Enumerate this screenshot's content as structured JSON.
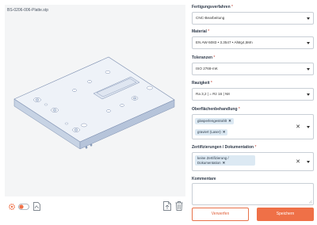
{
  "viewer": {
    "file_name": "BS-0206-006-Platte.stp"
  },
  "form": {
    "manufacturing": {
      "label": "Fertigungsverfahren",
      "value": "CNC-Bearbeitung"
    },
    "material": {
      "label": "Material",
      "value": "EN AW-5083 • 3.3547 • AlMg4,5Mn"
    },
    "tolerances": {
      "label": "Toleranzen",
      "value": "ISO 2768-mK"
    },
    "roughness": {
      "label": "Rauigkeit",
      "value": "Ra 3,2 | = Rz 16 | N8"
    },
    "surface": {
      "label": "Oberflächenbehandlung",
      "chips": [
        "glasperlengestrahlt",
        "graviert (Laser)"
      ]
    },
    "certs": {
      "label": "Zertifizierungen / Dokumentation",
      "chips": [
        "keine Zertifizierung / Dokumentation"
      ]
    },
    "comments": {
      "label": "Kommentare",
      "value": ""
    },
    "required_marker": "*",
    "chip_remove": "✕",
    "clear_all": "✕"
  },
  "actions": {
    "discard_label": "Verwerfen",
    "save_label": "Speichern"
  },
  "colors": {
    "accent": "#ef7047",
    "chip_bg": "#dce9f3",
    "viewer_bg": "#f4f5f6"
  }
}
